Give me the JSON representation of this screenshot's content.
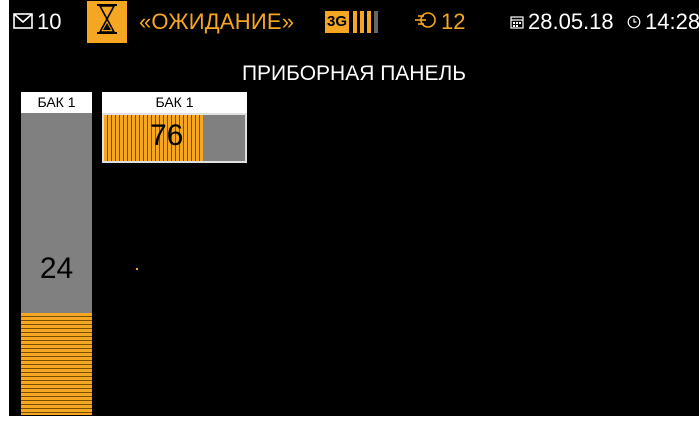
{
  "status_bar": {
    "messages_count": "10",
    "mode": "«ОЖИДАНИЕ»",
    "network": "3G",
    "signal_level": 3,
    "signal_max": 4,
    "satellites": "12",
    "date": "28.05.18",
    "time": "14:28"
  },
  "page_title": "ПРИБОРНАЯ ПАНЕЛЬ",
  "tanks": [
    {
      "label": "БАК 1",
      "value": "24",
      "orientation": "vertical",
      "fill_percent": 24
    },
    {
      "label": "БАК 1",
      "value": "76",
      "orientation": "horizontal",
      "fill_percent": 76
    }
  ],
  "colors": {
    "accent": "#f5a623",
    "background": "#000000",
    "empty": "#808080",
    "text": "#ffffff"
  }
}
